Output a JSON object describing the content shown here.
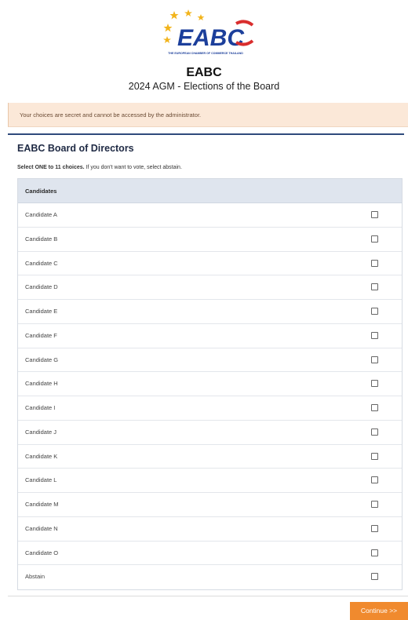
{
  "logo": {
    "text": "EABC",
    "tagline": "THE EUROPEAN CHAMBER OF COMMERCE THAILAND",
    "colors": {
      "blue": "#1c3f9b",
      "red": "#d92d2d",
      "star": "#f2b41c"
    }
  },
  "header": {
    "title": "EABC",
    "subtitle": "2024 AGM - Elections of the Board"
  },
  "notice": {
    "text": "Your choices are secret and cannot be accessed by the administrator."
  },
  "ballot": {
    "title": "EABC Board of Directors",
    "instruction_bold": "Select ONE to 11 choices.",
    "instruction_rest": " If you don't want to vote, select abstain.",
    "column_header": "Candidates",
    "options": [
      "Candidate A",
      "Candidate B",
      "Candidate C",
      "Candidate D",
      "Candidate E",
      "Candidate F",
      "Candidate G",
      "Candidate H",
      "Candidate I",
      "Candidate J",
      "Candidate K",
      "Candidate L",
      "Candidate M",
      "Candidate N",
      "Candidate O",
      "Abstain"
    ]
  },
  "footer": {
    "continue_label": "Continue >>"
  },
  "colors": {
    "accent_orange": "#f08a2e",
    "notice_bg": "#fbe8d8",
    "header_bar": "#2f4a7c"
  }
}
